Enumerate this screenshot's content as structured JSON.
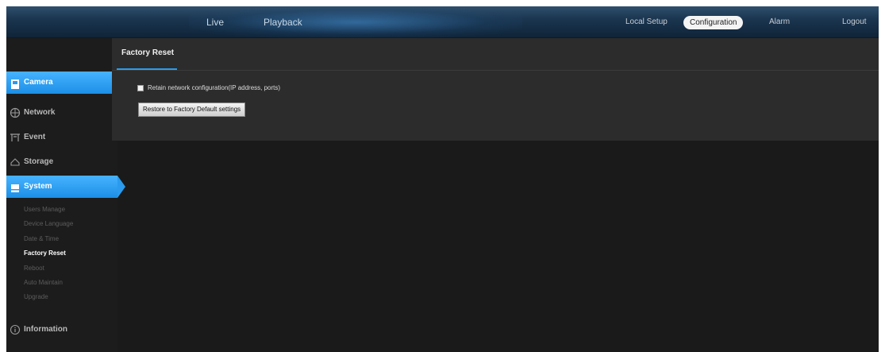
{
  "topnav": {
    "live": "Live",
    "playback": "Playback",
    "local_setup": "Local Setup",
    "configuration": "Configuration",
    "alarm": "Alarm",
    "logout": "Logout"
  },
  "sidebar": {
    "items": [
      {
        "label": "Camera",
        "icon": "camera-icon",
        "active": true
      },
      {
        "label": "Network",
        "icon": "network-icon",
        "active": false
      },
      {
        "label": "Event",
        "icon": "event-icon",
        "active": false
      },
      {
        "label": "Storage",
        "icon": "storage-icon",
        "active": false
      },
      {
        "label": "System",
        "icon": "system-icon",
        "active": true
      },
      {
        "label": "Information",
        "icon": "info-icon",
        "active": false
      }
    ],
    "system_sub": [
      {
        "label": "Users Manage",
        "active": false
      },
      {
        "label": "Device Language",
        "active": false
      },
      {
        "label": "Date & Time",
        "active": false
      },
      {
        "label": "Factory Reset",
        "active": true
      },
      {
        "label": "Reboot",
        "active": false
      },
      {
        "label": "Auto Maintain",
        "active": false
      },
      {
        "label": "Upgrade",
        "active": false
      }
    ]
  },
  "main": {
    "title": "Factory Reset",
    "retain_label": "Retain network configuration(IP address, ports)",
    "retain_checked": false,
    "restore_button": "Restore to Factory Default settings"
  },
  "colors": {
    "accent": "#2a9bee",
    "background": "#1a1a1a",
    "panel": "#2c2c2c"
  }
}
